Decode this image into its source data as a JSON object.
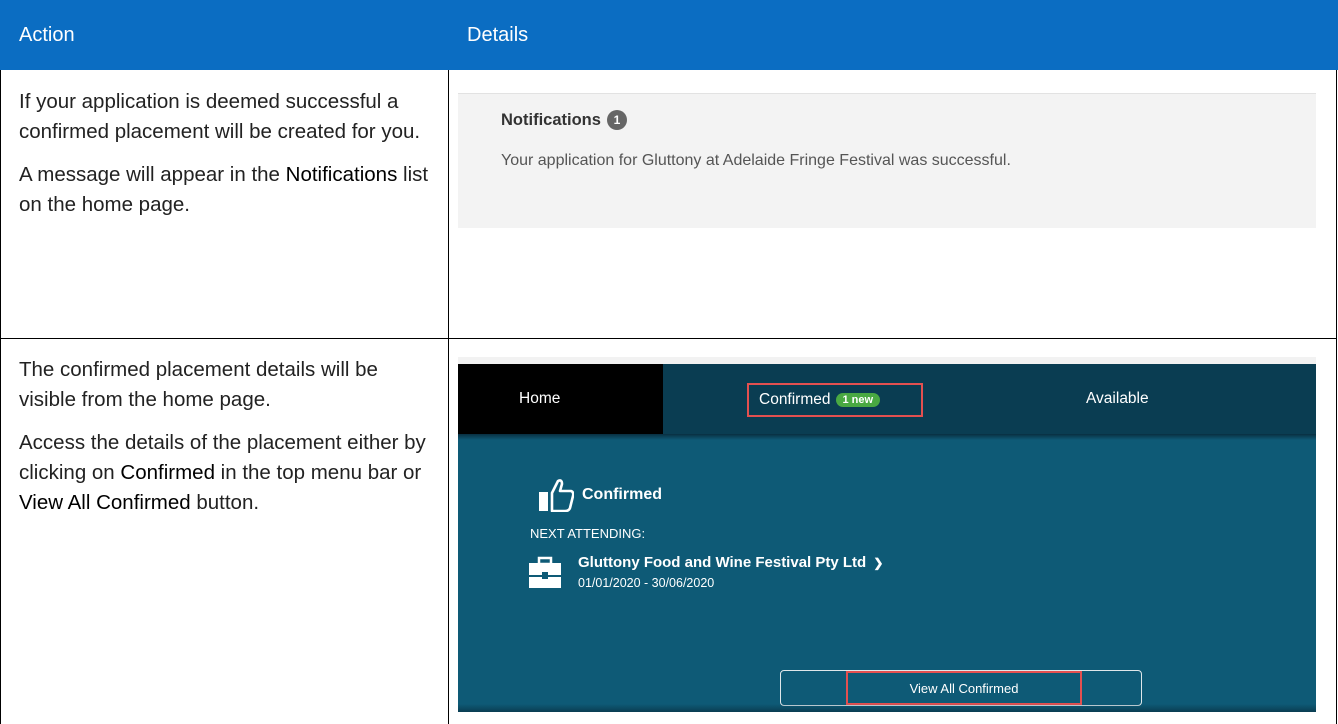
{
  "table": {
    "headers": {
      "action": "Action",
      "details": "Details"
    },
    "row1": {
      "para1": "If your application is deemed successful a confirmed placement will be created for you.",
      "para2_pre": "A message will appear in the ",
      "para2_bold": "Notifications",
      "para2_post": " list on the home page."
    },
    "row2": {
      "para1": "The confirmed placement details will be visible from the home page.",
      "para2_pre": "Access the details of the placement either by clicking on ",
      "para2_bold1": "Confirmed",
      "para2_mid": " in the top menu bar or ",
      "para2_bold2": "View All Confirmed",
      "para2_post": " button."
    }
  },
  "notifications": {
    "title": "Notifications",
    "count": "1",
    "message": "Your application for Gluttony at Adelaide Fringe Festival was successful."
  },
  "dashboard": {
    "nav": {
      "home": "Home",
      "confirmed": "Confirmed",
      "new_badge": "1 new",
      "available": "Available"
    },
    "section_title": "Confirmed",
    "next_label": "NEXT ATTENDING:",
    "venue": "Gluttony Food and Wine Festival Pty Ltd",
    "chevron": "❯",
    "dates": "01/01/2020 - 30/06/2020",
    "view_all": "View All Confirmed"
  },
  "colors": {
    "header_blue": "#0b6dc2",
    "dash_teal": "#0e5a76",
    "nav_dark": "#0a3d52",
    "highlight_red": "#e35050",
    "badge_green": "#49a942"
  },
  "icons": [
    "thumbs-up-icon",
    "briefcase-icon",
    "chevron-right-icon"
  ]
}
